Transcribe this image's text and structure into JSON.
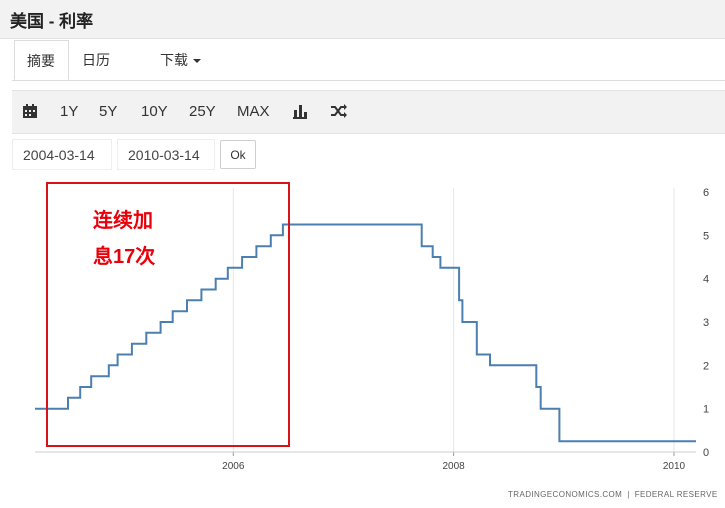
{
  "page": {
    "title": "美国 - 利率"
  },
  "tabs": [
    {
      "label": "摘要",
      "active": true
    },
    {
      "label": "日历",
      "active": false
    },
    {
      "label": "下载",
      "active": false,
      "has_dropdown": true
    }
  ],
  "toolbar": {
    "calendar_icon": "calendar-icon",
    "ranges": [
      "1Y",
      "5Y",
      "10Y",
      "25Y",
      "MAX"
    ],
    "chart_type_icon": "bar-chart-icon",
    "compare_icon": "shuffle-icon"
  },
  "date_range": {
    "start": "2004-03-14",
    "end": "2010-03-14",
    "ok_label": "Ok"
  },
  "annotation": {
    "line1": "连续加",
    "line2": "息17次",
    "color": "#e8000b",
    "box_color": "#d9121a"
  },
  "source": {
    "left": "TRADINGECONOMICS.COM",
    "separator": "|",
    "right": "FEDERAL RESERVE"
  },
  "colors": {
    "line": "#4a7fb0",
    "grid": "#e6e6e6"
  },
  "chart_data": {
    "type": "line",
    "title": "",
    "xlabel": "",
    "ylabel": "",
    "x_tick_labels": [
      "2006",
      "2008",
      "2010"
    ],
    "x_ticks": [
      2006,
      2008,
      2010
    ],
    "y_ticks": [
      0,
      1,
      2,
      3,
      4,
      5,
      6
    ],
    "xlim": [
      2004.2,
      2010.2
    ],
    "ylim": [
      0,
      6
    ],
    "grid": true,
    "y_axis_side": "right",
    "series": [
      {
        "x": [
          2004.2,
          2004.5,
          2004.61,
          2004.71,
          2004.87,
          2004.95,
          2005.08,
          2005.21,
          2005.34,
          2005.45,
          2005.58,
          2005.71,
          2005.84,
          2005.95,
          2006.08,
          2006.21,
          2006.34,
          2006.45,
          2006.53,
          2007.71,
          2007.81,
          2007.88,
          2008.05,
          2008.08,
          2008.12,
          2008.21,
          2008.33,
          2008.75,
          2008.79,
          2008.96,
          2010.2
        ],
        "y": [
          1.0,
          1.25,
          1.5,
          1.75,
          2.0,
          2.25,
          2.5,
          2.75,
          3.0,
          3.25,
          3.5,
          3.75,
          4.0,
          4.25,
          4.5,
          4.75,
          5.0,
          5.25,
          5.25,
          4.75,
          4.5,
          4.25,
          3.5,
          3.0,
          3.0,
          2.25,
          2.0,
          1.5,
          1.0,
          0.25,
          0.25
        ],
        "step": "after"
      }
    ]
  }
}
